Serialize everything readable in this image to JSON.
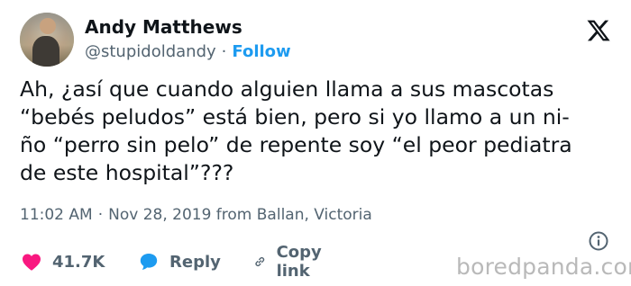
{
  "author": {
    "name": "Andy Matthews",
    "handle": "@stupidoldandy",
    "separator": "·",
    "follow_label": "Follow"
  },
  "icons": {
    "brand": "x-logo-icon",
    "info": "info-icon",
    "like": "heart-icon",
    "reply": "speech-bubble-icon",
    "copy": "link-icon"
  },
  "tweet": {
    "lines": [
      "Ah, ¿así que cuando alguien llama a sus mascotas",
      "“bebés peludos” está bien, pero si yo llamo a un ni-",
      "ño “perro sin pelo” de repente soy “el peor pediatra",
      "de este hospital”???"
    ]
  },
  "meta": {
    "time": "11:02 AM",
    "separator": "·",
    "date": "Nov 28, 2019 from Ballan, Victoria"
  },
  "actions": {
    "likes": "41.7K",
    "reply_label": "Reply",
    "copy_label": "Copy link"
  },
  "watermark": "boredpanda.com",
  "colors": {
    "accent": "#1d9bf0",
    "like": "#f91880",
    "text": "#0f1419",
    "muted": "#536471"
  }
}
